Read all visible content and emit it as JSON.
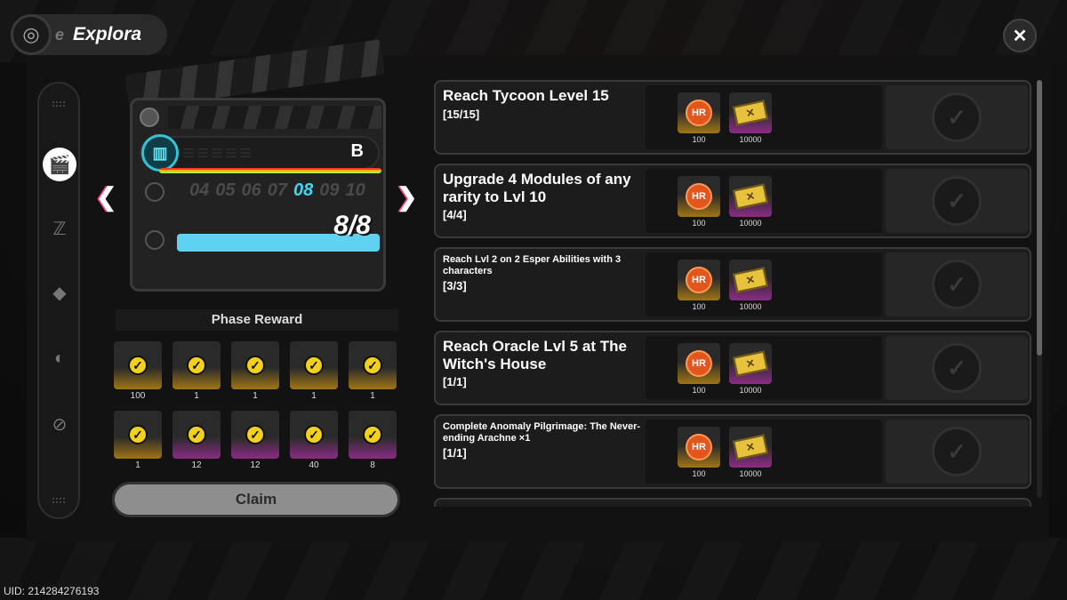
{
  "header": {
    "title": "Explora",
    "title_prefix": "e"
  },
  "close_glyph": "✕",
  "sidenav": {
    "items": [
      {
        "icon": "clapperboard-icon",
        "glyph": "🎬",
        "active": true
      },
      {
        "icon": "z-logo-icon",
        "glyph": "ℤ",
        "active": false
      },
      {
        "icon": "shard-icon",
        "glyph": "◆",
        "active": false
      },
      {
        "icon": "helmet-icon",
        "glyph": "◐",
        "active": false
      },
      {
        "icon": "eye-slash-icon",
        "glyph": "⊘",
        "active": false
      }
    ]
  },
  "board": {
    "grade": "B",
    "days": [
      "04",
      "05",
      "06",
      "07",
      "08",
      "09",
      "10"
    ],
    "current_day": "08",
    "progress_text": "8/8",
    "progress_fraction": 1.0
  },
  "phase_reward": {
    "label": "Phase Reward",
    "items": [
      {
        "count": "100",
        "style": "gold"
      },
      {
        "count": "1",
        "style": "gold"
      },
      {
        "count": "1",
        "style": "gold"
      },
      {
        "count": "1",
        "style": "gold"
      },
      {
        "count": "1",
        "style": "gold"
      },
      {
        "count": "1",
        "style": "gold"
      },
      {
        "count": "12",
        "style": "purple"
      },
      {
        "count": "12",
        "style": "purple"
      },
      {
        "count": "40",
        "style": "purple"
      },
      {
        "count": "8",
        "style": "purple"
      }
    ],
    "claim_label": "Claim"
  },
  "tasks": [
    {
      "title": "Reach Tycoon Level 15",
      "progress": "[15/15]",
      "size": "big",
      "rewards": [
        "100",
        "10000"
      ]
    },
    {
      "title": "Upgrade 4 Modules of any rarity to Lvl 10",
      "progress": "[4/4]",
      "size": "big",
      "rewards": [
        "100",
        "10000"
      ]
    },
    {
      "title": "Reach Lvl 2 on 2 Esper Abilities with 3 characters",
      "progress": "[3/3]",
      "size": "small",
      "rewards": [
        "100",
        "10000"
      ]
    },
    {
      "title": "Reach Oracle Lvl 5 at The Witch's House",
      "progress": "[1/1]",
      "size": "big",
      "rewards": [
        "100",
        "10000"
      ]
    },
    {
      "title": "Complete Anomaly Pilgrimage: The Never-ending Arachne ×1",
      "progress": "[1/1]",
      "size": "small",
      "rewards": [
        "100",
        "10000"
      ]
    }
  ],
  "uid_text": "UID: 214284276193",
  "colors": {
    "accent_cyan": "#5ed2f0",
    "check_yellow": "#f2d11c",
    "arrow_pink": "#ff3e7a"
  }
}
